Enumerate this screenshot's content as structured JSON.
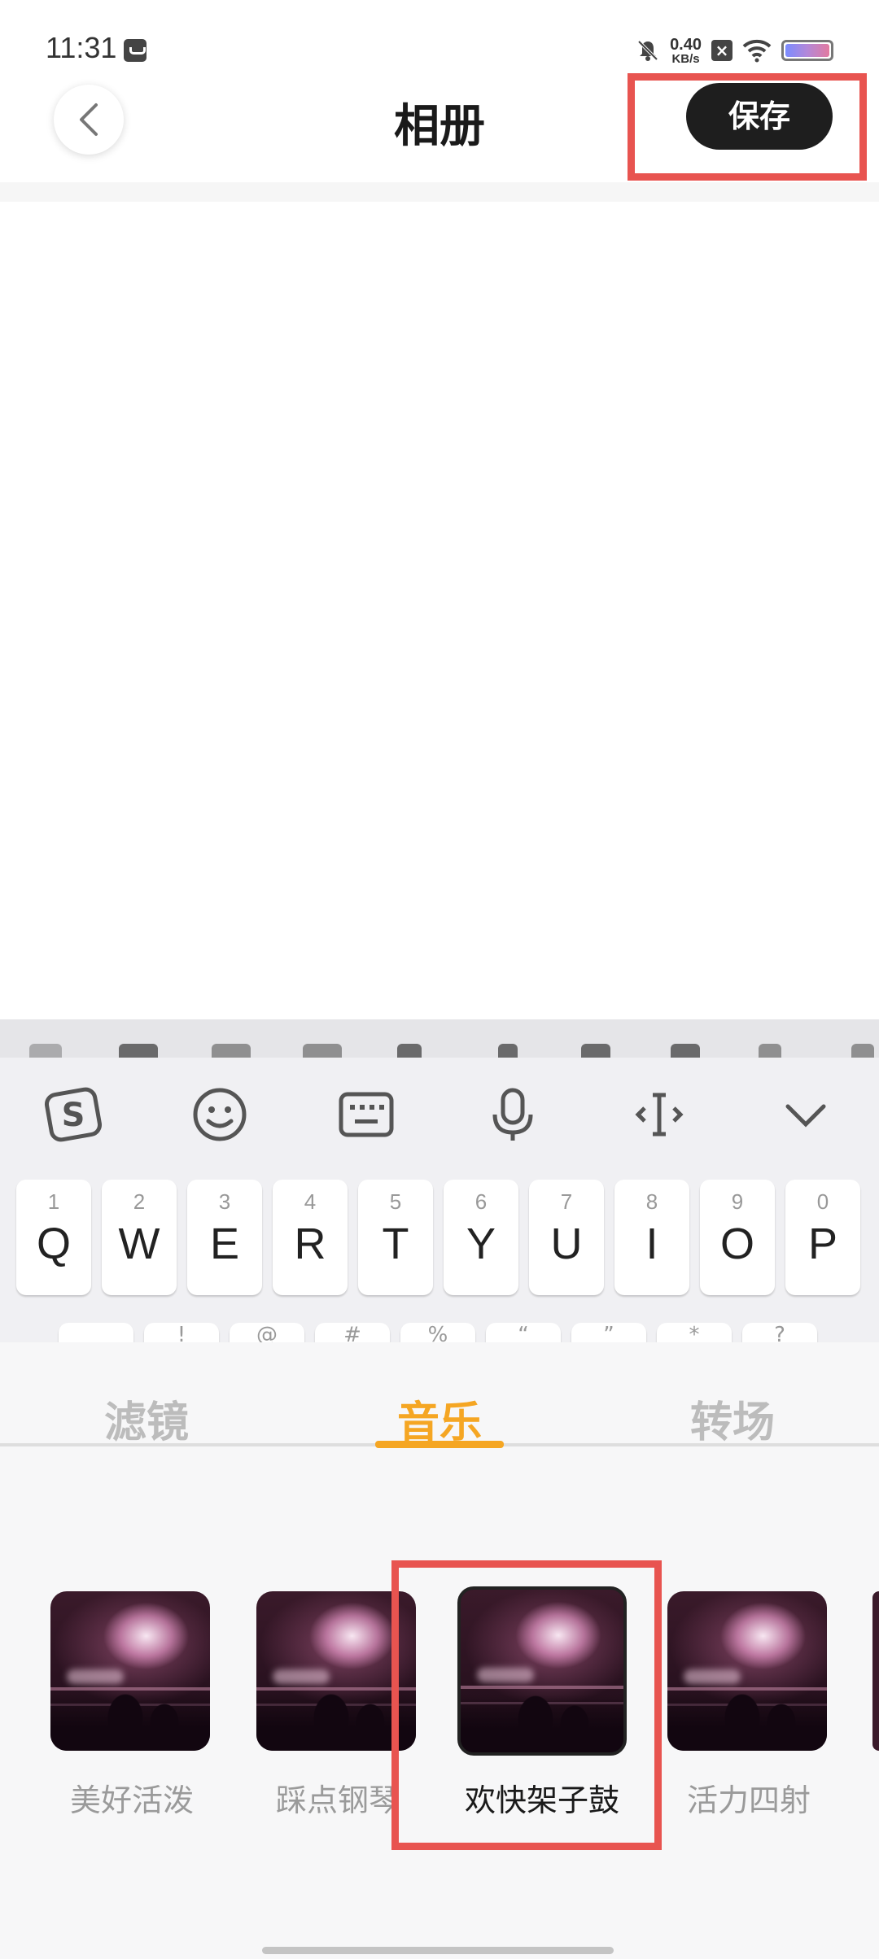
{
  "status_bar": {
    "time": "11:31",
    "net_speed_value": "0.40",
    "net_speed_unit": "KB/s"
  },
  "header": {
    "title": "相册",
    "save_label": "保存"
  },
  "keyboard": {
    "keys": [
      {
        "num": "1",
        "char": "Q"
      },
      {
        "num": "2",
        "char": "W"
      },
      {
        "num": "3",
        "char": "E"
      },
      {
        "num": "4",
        "char": "R"
      },
      {
        "num": "5",
        "char": "T"
      },
      {
        "num": "6",
        "char": "Y"
      },
      {
        "num": "7",
        "char": "U"
      },
      {
        "num": "8",
        "char": "I"
      },
      {
        "num": "9",
        "char": "O"
      },
      {
        "num": "0",
        "char": "P"
      }
    ],
    "second_row_symbols": [
      "",
      "!",
      "@",
      "#",
      "%",
      "“",
      "”",
      "*",
      "?"
    ]
  },
  "editor": {
    "tabs": [
      "滤镜",
      "音乐",
      "转场"
    ],
    "active_tab": "音乐",
    "music_items": [
      {
        "label": "美好活泼",
        "selected": false
      },
      {
        "label": "踩点钢琴",
        "selected": false
      },
      {
        "label": "欢快架子鼓",
        "selected": true
      },
      {
        "label": "活力四射",
        "selected": false
      }
    ]
  },
  "colors": {
    "accent": "#f5a623",
    "highlight": "#e85450",
    "save_button": "#1e1e1e"
  }
}
